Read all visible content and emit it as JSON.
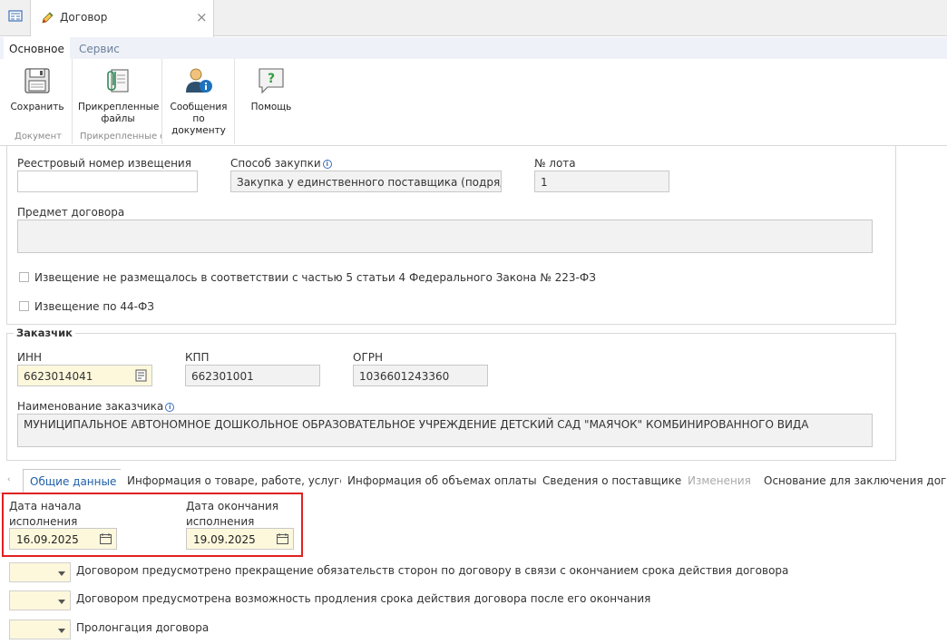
{
  "window": {
    "tab_title": "Договор",
    "close_symbol": "×"
  },
  "ribbon": {
    "tabs": [
      "Основное",
      "Сервис"
    ],
    "buttons": {
      "save": "Сохранить",
      "attached_line1": "Прикрепленные",
      "attached_line2": "файлы",
      "messages_line1": "Сообщения по",
      "messages_line2": "документу",
      "help": "Помощь"
    },
    "groups": {
      "document": "Документ",
      "attached": "Прикрепленные ф"
    }
  },
  "procurement": {
    "registry_label": "Реестровый номер извещения",
    "registry_value": "",
    "method_label": "Способ закупки",
    "method_value": "Закупка у единственного поставщика (подрядчика",
    "lot_label": "№ лота",
    "lot_value": "1",
    "subject_label": "Предмет договора",
    "subject_value": "",
    "checkbox1": "Извещение не размещалось в соответствии с частью 5 статьи 4 Федерального Закона № 223-ФЗ",
    "checkbox2": "Извещение по 44-ФЗ"
  },
  "customer": {
    "section_title": "Заказчик",
    "inn_label": "ИНН",
    "inn_value": "6623014041",
    "kpp_label": "КПП",
    "kpp_value": "662301001",
    "ogrn_label": "ОГРН",
    "ogrn_value": "1036601243360",
    "name_label": "Наименование заказчика",
    "name_value": "МУНИЦИПАЛЬНОЕ АВТОНОМНОЕ ДОШКОЛЬНОЕ ОБРАЗОВАТЕЛЬНОЕ УЧРЕЖДЕНИЕ  ДЕТСКИЙ САД \"МАЯЧОК\" КОМБИНИРОВАННОГО ВИДА"
  },
  "bottom_tabs": [
    "Общие данные",
    "Информация о товаре, работе, услуге",
    "Информация об объемах оплаты",
    "Сведения о поставщике",
    "Изменения",
    "Основание для заключения догово"
  ],
  "general": {
    "start_label_1": "Дата начала",
    "start_label_2": "исполнения",
    "start_value": "16.09.2025",
    "end_label_1": "Дата окончания",
    "end_label_2": "исполнения",
    "end_value": "19.09.2025",
    "option1": "Договором предусмотрено прекращение обязательств сторон по договору в связи с окончанием срока действия договора",
    "option2": "Договором предусмотрена возможность продления срока действия договора после его окончания",
    "option3": "Пролонгация договора"
  },
  "colors": {
    "highlight_frame": "#e02020",
    "yellow_field": "#fdf8dc",
    "active_tab_text": "#1f5fa8"
  }
}
